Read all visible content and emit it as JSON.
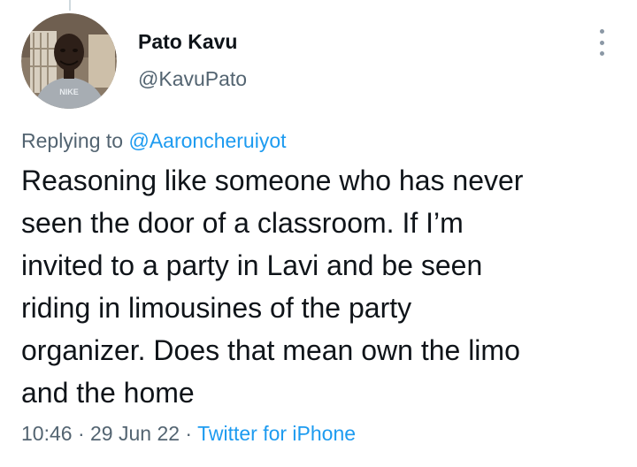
{
  "tweet": {
    "author_name": "Pato Kavu",
    "author_handle": "@KavuPato",
    "replying_prefix": "Replying to ",
    "replying_to": "@Aaroncheruiyot",
    "body_lines": [
      "Reasoning like someone who has never",
      "seen the door of a classroom. If I’m",
      "invited to a party in Lavi and be seen",
      "riding in limousines of the party",
      "organizer. Does that mean own the limo",
      "and the home"
    ],
    "time": "10:46",
    "separator": " · ",
    "date": "29 Jun 22",
    "source": "Twitter for iPhone",
    "avatar_shirt_text": "NIKE"
  },
  "colors": {
    "text": "#0f1419",
    "secondary": "#536471",
    "link": "#1d9bf0"
  },
  "icons": {
    "more": "more-vertical-icon"
  }
}
